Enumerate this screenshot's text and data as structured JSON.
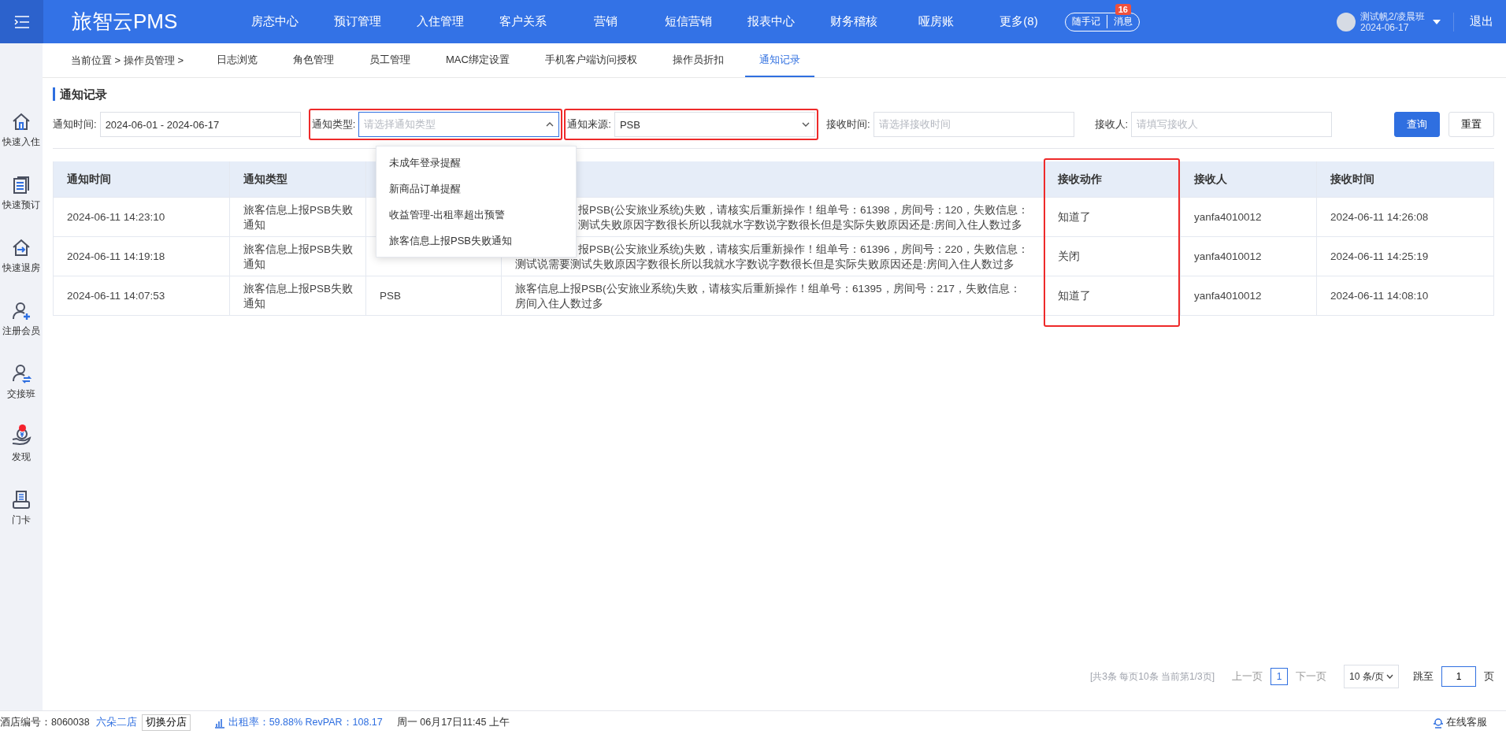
{
  "header": {
    "logo": "旅智云PMS",
    "nav": [
      {
        "label": "房态中心"
      },
      {
        "label": "预订管理"
      },
      {
        "label": "入住管理"
      },
      {
        "label": "客户关系"
      },
      {
        "label": "营销"
      },
      {
        "label": "短信营销"
      },
      {
        "label": "报表中心"
      },
      {
        "label": "财务稽核"
      },
      {
        "label": "哑房账"
      },
      {
        "label": "更多(8)"
      }
    ],
    "memo_button": "随手记",
    "message_button": "消息",
    "message_badge": "16",
    "user": {
      "name": "测试帆2/凌晨班",
      "date": "2024-06-17"
    },
    "logout": "退出"
  },
  "sidebar": {
    "items": [
      {
        "label": "快速入住",
        "kind": "house",
        "alert": false
      },
      {
        "label": "快速预订",
        "kind": "document",
        "alert": false
      },
      {
        "label": "快速退房",
        "kind": "exit",
        "alert": false
      },
      {
        "label": "注册会员",
        "kind": "user_add",
        "alert": false
      },
      {
        "label": "交接班",
        "kind": "user_swap",
        "alert": false
      },
      {
        "label": "发现",
        "kind": "coin_hand",
        "alert": true
      },
      {
        "label": "门卡",
        "kind": "card_printer",
        "alert": false
      }
    ]
  },
  "subnav": {
    "breadcrumb": "当前位置 > 操作员管理 >",
    "tabs": [
      {
        "label": "日志浏览",
        "selected": false
      },
      {
        "label": "角色管理",
        "selected": false
      },
      {
        "label": "员工管理",
        "selected": false
      },
      {
        "label": "MAC绑定设置",
        "selected": false
      },
      {
        "label": "手机客户端访问授权",
        "selected": false
      },
      {
        "label": "操作员折扣",
        "selected": false
      },
      {
        "label": "通知记录",
        "selected": true
      }
    ]
  },
  "page_title": "通知记录",
  "filters": [
    {
      "kind": "input",
      "label": "通知时间:",
      "value": "2024-06-01 - 2024-06-17",
      "highlighted": false
    },
    {
      "kind": "select",
      "label": "通知类型:",
      "placeholder": "请选择通知类型",
      "expanded": true,
      "highlighted": true
    },
    {
      "kind": "select",
      "label": "通知来源:",
      "value": "PSB",
      "expanded": false,
      "highlighted": true
    },
    {
      "kind": "input",
      "label": "接收时间:",
      "placeholder": "请选择接收时间",
      "highlighted": false
    },
    {
      "kind": "input",
      "label": "接收人:",
      "placeholder": "请填写接收人",
      "highlighted": false
    }
  ],
  "buttons": [
    {
      "label": "查询",
      "kind": "primary"
    },
    {
      "label": "重置",
      "kind": "default"
    }
  ],
  "dropdown": {
    "options": [
      "未成年登录提醒",
      "新商品订单提醒",
      "收益管理-出租率超出预警",
      "旅客信息上报PSB失败通知"
    ]
  },
  "table": {
    "columns": [
      {
        "label": "通知时间",
        "highlighted": false
      },
      {
        "label": "通知类型",
        "highlighted": false
      },
      {},
      {},
      {
        "label": "接收动作",
        "highlighted": true
      },
      {
        "label": "接收人",
        "highlighted": false
      },
      {
        "label": "接收时间",
        "highlighted": false
      }
    ],
    "rows": [
      {
        "notify_time": "2024-06-11 14:23:10",
        "type": "旅客信息上报PSB失败通知",
        "message": [
          {
            "kind": "partly_hidden",
            "text": "报PSB(公安旅业系统)失败，请核实后重新操作！组单号：61398，房间号：120，失败信息："
          },
          {
            "kind": "partly_hidden",
            "text": "测试失败原因字数很长所以我就水字数说字数很长但是实际失败原因还是:房间入住人数过多"
          }
        ],
        "action": "知道了",
        "receiver": "yanfa4010012",
        "receive_time": "2024-06-11 14:26:08"
      },
      {
        "notify_time": "2024-06-11 14:19:18",
        "type": "旅客信息上报PSB失败通知",
        "message": [
          {
            "kind": "partly_hidden",
            "text": "报PSB(公安旅业系统)失败，请核实后重新操作！组单号：61396，房间号：220，失败信息："
          },
          {
            "kind": "full",
            "text": "测试说需要测试失败原因字数很长所以我就水字数说字数很长但是实际失败原因还是:房间入住人数过多"
          }
        ],
        "action": "关闭",
        "receiver": "yanfa4010012",
        "receive_time": "2024-06-11 14:25:19"
      },
      {
        "notify_time": "2024-06-11 14:07:53",
        "type": "旅客信息上报PSB失败通知",
        "source": "PSB",
        "message": [
          {
            "kind": "wrap",
            "text": "旅客信息上报PSB(公安旅业系统)失败，请核实后重新操作！组单号：61395，房间号：217，失败信息：房间入住人数过多"
          }
        ],
        "action": "知道了",
        "receiver": "yanfa4010012",
        "receive_time": "2024-06-11 14:08:10"
      }
    ]
  },
  "pagination": {
    "summary": "[共3条 每页10条 当前第1/3页]",
    "prev": "上一页",
    "pages": [
      {
        "label": "1",
        "selected": true
      }
    ],
    "next": "下一页",
    "page_size": "10 条/页",
    "jump_label": "跳至",
    "jump_value": "1",
    "jump_unit": "页"
  },
  "status_bar": {
    "hotel_label": "酒店编号：8060038",
    "hotel_name": "六朵二店",
    "switch_button": "切换分店",
    "occupancy": "出租率：59.88% RevPAR：108.17",
    "datetime": "周一 06月17日11:45 上午",
    "support": "在线客服"
  }
}
